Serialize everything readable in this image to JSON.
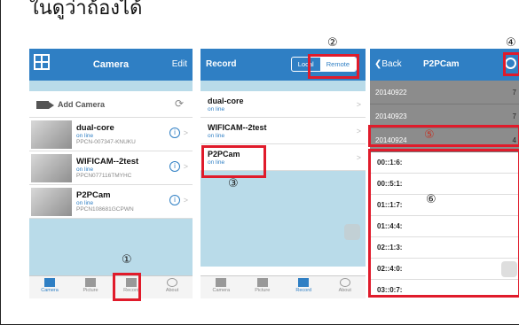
{
  "caption": "ในดูว่าถ้องได้",
  "panel1": {
    "title": "Camera",
    "edit_label": "Edit",
    "add_label": "Add Camera",
    "cameras": [
      {
        "name": "dual-core",
        "status": "on line",
        "id": "PPCN-007347-KNUKU"
      },
      {
        "name": "WIFICAM--2test",
        "status": "on line",
        "id": "PPCN077116TMYHC"
      },
      {
        "name": "P2PCam",
        "status": "on line",
        "id": "PPCN108681GCPWN"
      }
    ],
    "tabs": [
      "Camera",
      "Picture",
      "Record",
      "About"
    ]
  },
  "panel2": {
    "title": "Record",
    "local_label": "Local",
    "remote_label": "Remote",
    "records": [
      {
        "name": "dual-core",
        "status": "on line"
      },
      {
        "name": "WIFICAM--2test",
        "status": "on line"
      },
      {
        "name": "P2PCam",
        "status": "on line"
      }
    ],
    "tabs": [
      "Camera",
      "Picture",
      "Record",
      "About"
    ]
  },
  "panel3": {
    "back_label": "Back",
    "title": "P2PCam",
    "dates": [
      {
        "date": "20140922",
        "count": "7"
      },
      {
        "date": "20140923",
        "count": "7"
      },
      {
        "date": "20140924",
        "count": "4"
      }
    ],
    "times": [
      "00::1:6:",
      "00::5:1:",
      "01::1:7:",
      "01::4:4:",
      "02::1:3:",
      "02::4:0:",
      "03::0:7:"
    ]
  },
  "markers": {
    "m1": "①",
    "m2": "②",
    "m3": "③",
    "m4": "④",
    "m5": "⑤",
    "m6": "⑥"
  },
  "colors": {
    "brand": "#2f7fc4",
    "highlight": "#e01b2b",
    "list_bg": "#b9dbe9"
  }
}
